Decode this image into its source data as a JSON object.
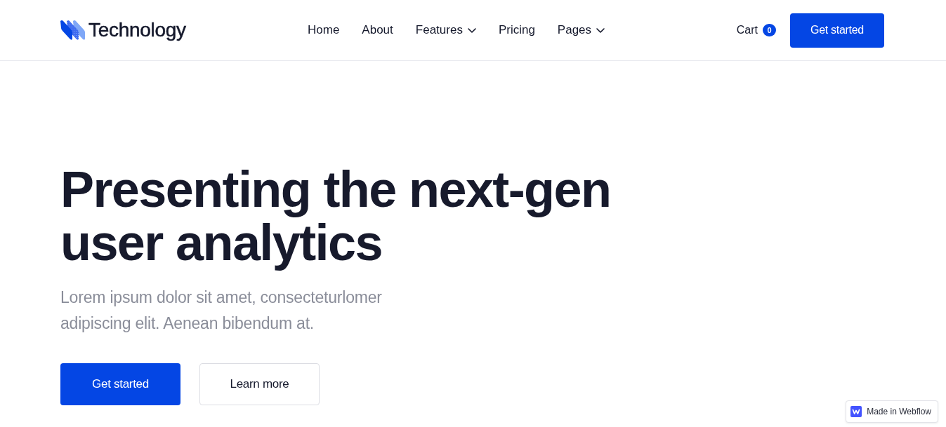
{
  "header": {
    "logo": {
      "text": "Technology"
    },
    "nav": [
      {
        "label": "Home",
        "dropdown": false
      },
      {
        "label": "About",
        "dropdown": false
      },
      {
        "label": "Features",
        "dropdown": true
      },
      {
        "label": "Pricing",
        "dropdown": false
      },
      {
        "label": "Pages",
        "dropdown": true
      }
    ],
    "cart": {
      "label": "Cart",
      "count": "0"
    },
    "cta": {
      "label": "Get started"
    }
  },
  "hero": {
    "title": "Presenting the next-gen user analytics",
    "text": "Lorem ipsum dolor sit amet, consecteturlomer adipiscing elit. Aenean bibendum at.",
    "buttons": [
      {
        "label": "Get started",
        "kind": "primary"
      },
      {
        "label": "Learn more",
        "kind": "secondary"
      }
    ]
  },
  "badge": {
    "label": "Made in Webflow"
  }
}
